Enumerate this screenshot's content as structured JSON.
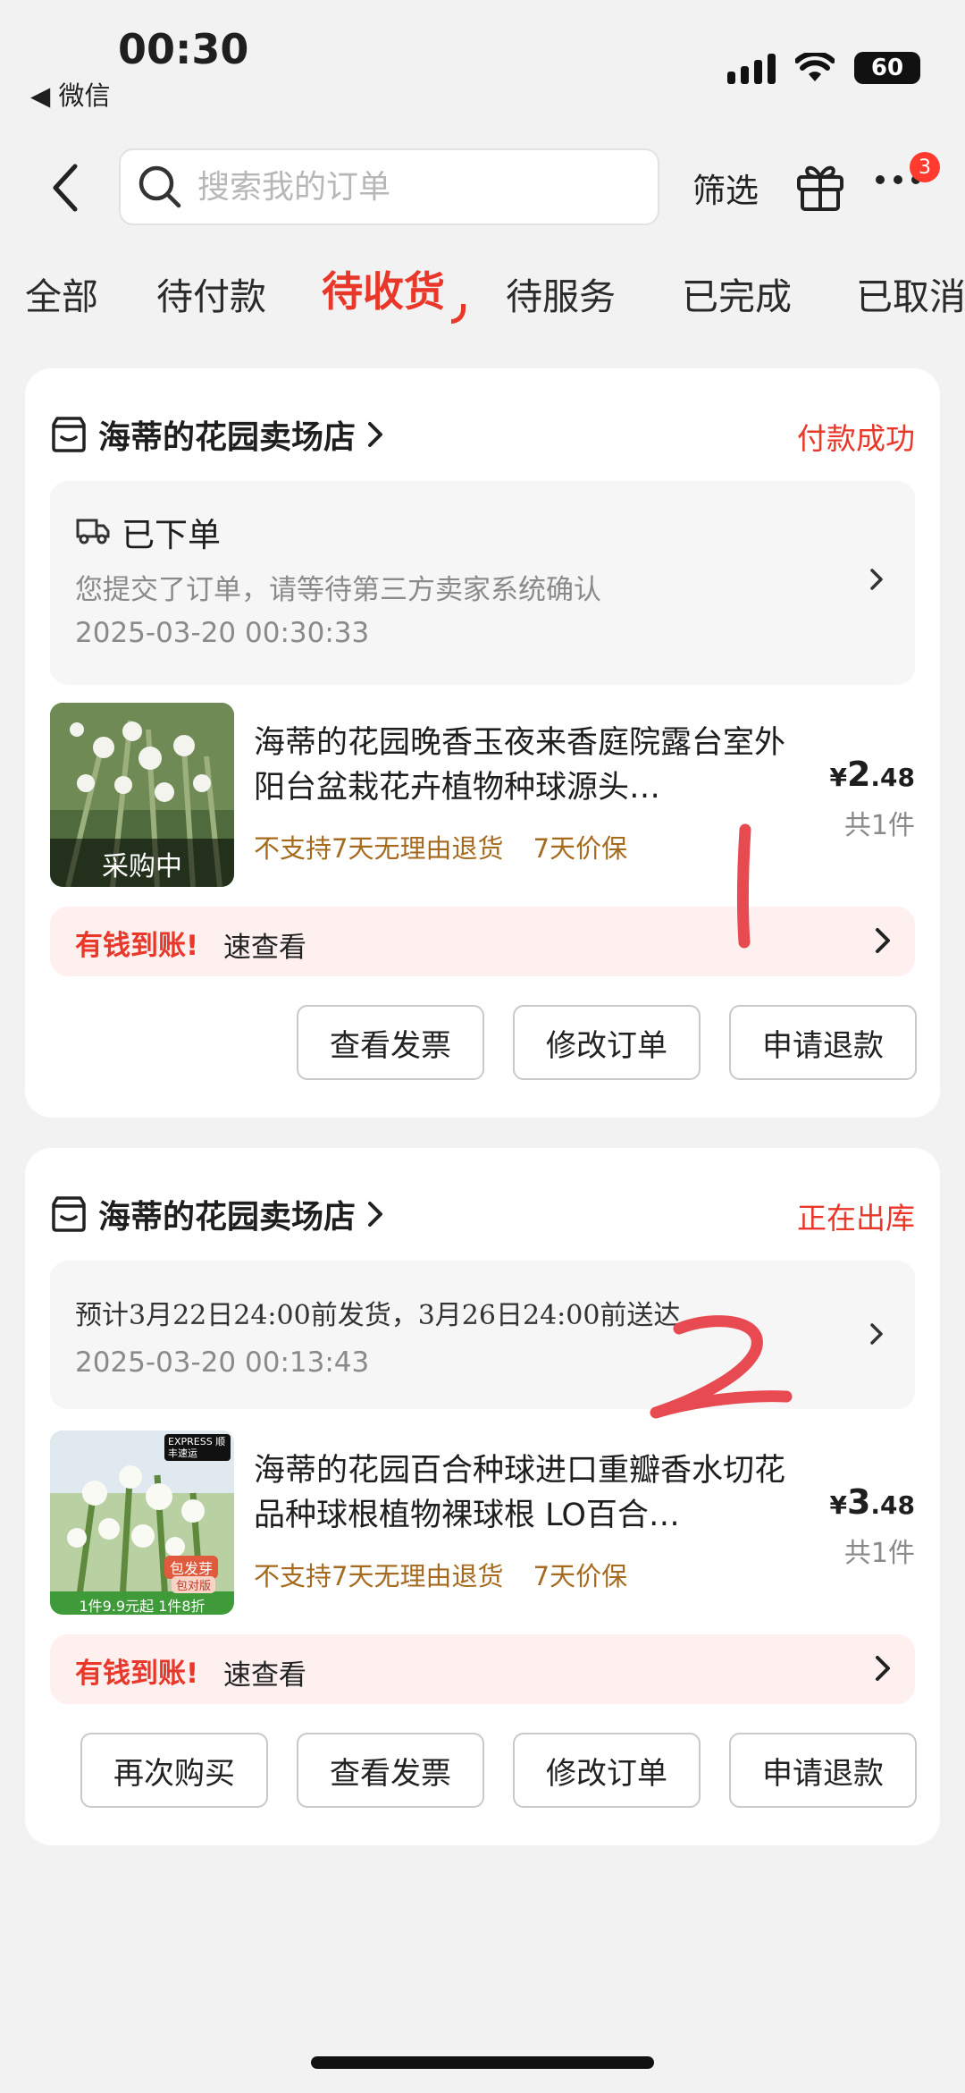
{
  "status_bar": {
    "time": "00:30",
    "back_app": "◀ 微信",
    "battery": "60"
  },
  "header": {
    "search_placeholder": "搜索我的订单",
    "filter_label": "筛选",
    "more_badge": "3"
  },
  "tabs": [
    {
      "label": "全部"
    },
    {
      "label": "待付款"
    },
    {
      "label": "待收货"
    },
    {
      "label": "待服务"
    },
    {
      "label": "已完成"
    },
    {
      "label": "已取消"
    }
  ],
  "orders": [
    {
      "shop_name": "海蒂的花园卖场店",
      "status": "付款成功",
      "info_title": "已下单",
      "info_desc": "您提交了订单，请等待第三方卖家系统确认",
      "info_date": "2025-03-20 00:30:33",
      "product_title": "海蒂的花园晚香玉夜来香庭院露台室外阳台盆栽花卉植物种球源头…",
      "thumb_overlay": "采购中",
      "tags": [
        "不支持7天无理由退货",
        "7天价保"
      ],
      "price_symbol": "¥",
      "price_int": "2",
      "price_dec": ".48",
      "qty": "共1件",
      "promo_a": "有钱到账!",
      "promo_b": "速查看",
      "buttons": [
        "查看发票",
        "修改订单",
        "申请退款"
      ]
    },
    {
      "shop_name": "海蒂的花园卖场店",
      "status": "正在出库",
      "info_ship": "预计3月22日24:00前发货，3月26日24:00前送达",
      "info_date": "2025-03-20 00:13:43",
      "product_title": "海蒂的花园百合种球进口重瓣香水切花品种球根植物裸球根 LO百合…",
      "thumb_badge": "EXPRESS 顺丰速运",
      "thumb_tag": "包发芽",
      "thumb_tag2": "包对版",
      "thumb_footer": "1件9.9元起 1件8折",
      "tags": [
        "不支持7天无理由退货",
        "7天价保"
      ],
      "price_symbol": "¥",
      "price_int": "3",
      "price_dec": ".48",
      "qty": "共1件",
      "promo_a": "有钱到账!",
      "promo_b": "速查看",
      "buttons": [
        "再次购买",
        "查看发票",
        "修改订单",
        "申请退款"
      ]
    }
  ],
  "annotations": [
    "1",
    "2"
  ]
}
